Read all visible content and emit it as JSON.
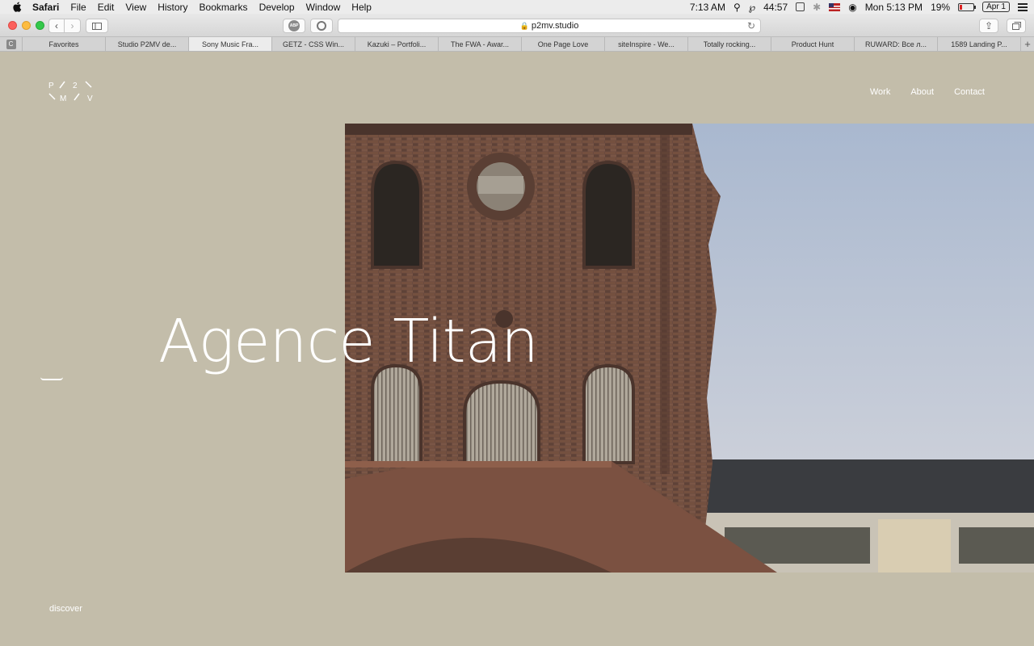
{
  "menubar": {
    "app": "Safari",
    "items": [
      "File",
      "Edit",
      "View",
      "History",
      "Bookmarks",
      "Develop",
      "Window",
      "Help"
    ],
    "time_left": "7:13 AM",
    "timer": "44:57",
    "clock": "Mon 5:13 PM",
    "battery": "19%",
    "date_badge": "Apr 1"
  },
  "toolbar": {
    "url": "p2mv.studio",
    "abp_label": "ABP"
  },
  "tabs": {
    "pinned_label": "C",
    "items": [
      "Favorites",
      "Studio P2MV de...",
      "Sony Music Fra...",
      "GETZ - CSS Win...",
      "Kazuki – Portfoli...",
      "The FWA - Awar...",
      "One Page Love",
      "siteInspire - We...",
      "Totally rocking...",
      "Product Hunt",
      "RUWARD: Все л...",
      "1589 Landing P..."
    ],
    "active_index": 2
  },
  "site": {
    "logo_letters": [
      "P",
      "2",
      "M",
      "V"
    ],
    "nav": [
      "Work",
      "About",
      "Contact"
    ],
    "hero_title": "Agence Titan",
    "discover": "discover"
  },
  "colors": {
    "page_bg": "#c3bdaa",
    "text": "#ffffff",
    "brick": "#6b4a3e",
    "sky": "#b6c3d6"
  }
}
